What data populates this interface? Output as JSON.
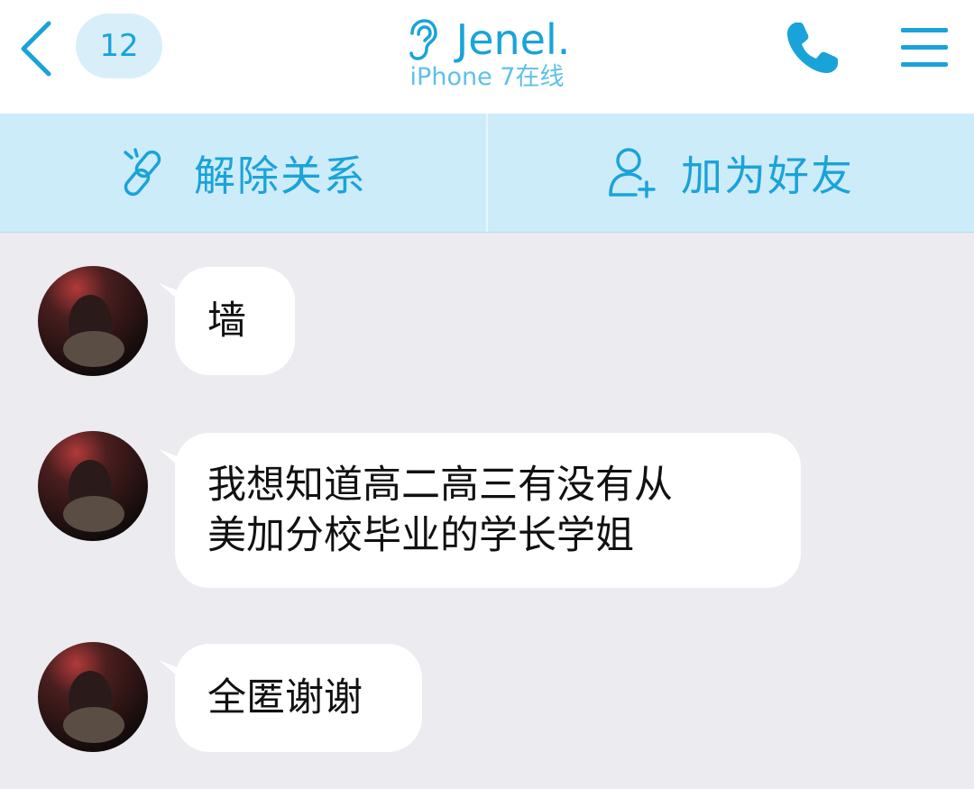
{
  "header": {
    "unread_count": "12",
    "contact_name": "Jenel.",
    "status": "iPhone 7在线",
    "icons": {
      "back": "chevron-left-icon",
      "ear": "ear-icon",
      "call": "phone-icon",
      "menu": "menu-icon"
    }
  },
  "actions": [
    {
      "label": "解除关系",
      "icon": "unlink-icon"
    },
    {
      "label": "加为好友",
      "icon": "add-friend-icon"
    }
  ],
  "messages": [
    {
      "text": "墙"
    },
    {
      "text": "我想知道高二高三有没有从\n美加分校毕业的学长学姐"
    },
    {
      "text": "全匿谢谢"
    }
  ],
  "colors": {
    "accent": "#1aa3d9",
    "header_bg": "#ffffff",
    "action_bar_bg": "#cdecf9",
    "chat_bg": "#ebebf0",
    "bubble_bg": "#ffffff",
    "badge_bg": "#d8effa"
  }
}
